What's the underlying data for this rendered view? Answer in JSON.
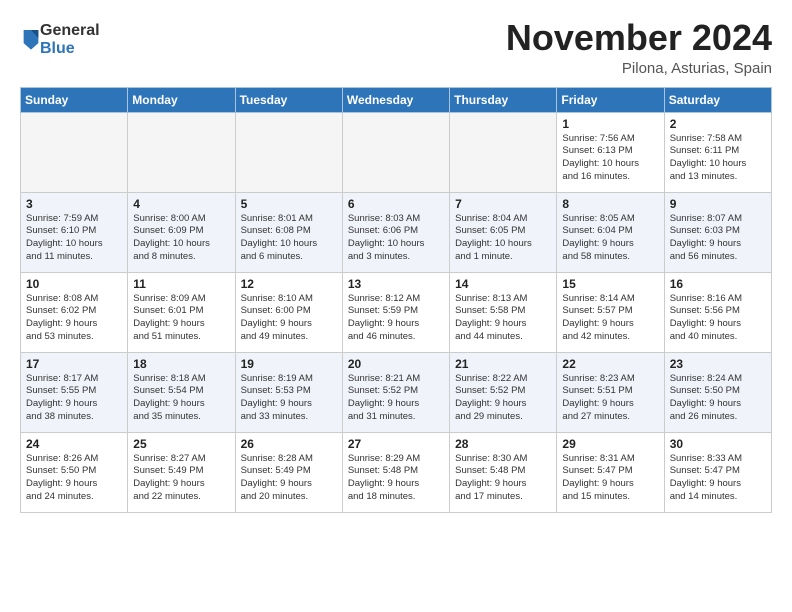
{
  "logo": {
    "general": "General",
    "blue": "Blue"
  },
  "header": {
    "month": "November 2024",
    "location": "Pilona, Asturias, Spain"
  },
  "weekdays": [
    "Sunday",
    "Monday",
    "Tuesday",
    "Wednesday",
    "Thursday",
    "Friday",
    "Saturday"
  ],
  "weeks": [
    [
      {
        "day": "",
        "info": ""
      },
      {
        "day": "",
        "info": ""
      },
      {
        "day": "",
        "info": ""
      },
      {
        "day": "",
        "info": ""
      },
      {
        "day": "",
        "info": ""
      },
      {
        "day": "1",
        "info": "Sunrise: 7:56 AM\nSunset: 6:13 PM\nDaylight: 10 hours\nand 16 minutes."
      },
      {
        "day": "2",
        "info": "Sunrise: 7:58 AM\nSunset: 6:11 PM\nDaylight: 10 hours\nand 13 minutes."
      }
    ],
    [
      {
        "day": "3",
        "info": "Sunrise: 7:59 AM\nSunset: 6:10 PM\nDaylight: 10 hours\nand 11 minutes."
      },
      {
        "day": "4",
        "info": "Sunrise: 8:00 AM\nSunset: 6:09 PM\nDaylight: 10 hours\nand 8 minutes."
      },
      {
        "day": "5",
        "info": "Sunrise: 8:01 AM\nSunset: 6:08 PM\nDaylight: 10 hours\nand 6 minutes."
      },
      {
        "day": "6",
        "info": "Sunrise: 8:03 AM\nSunset: 6:06 PM\nDaylight: 10 hours\nand 3 minutes."
      },
      {
        "day": "7",
        "info": "Sunrise: 8:04 AM\nSunset: 6:05 PM\nDaylight: 10 hours\nand 1 minute."
      },
      {
        "day": "8",
        "info": "Sunrise: 8:05 AM\nSunset: 6:04 PM\nDaylight: 9 hours\nand 58 minutes."
      },
      {
        "day": "9",
        "info": "Sunrise: 8:07 AM\nSunset: 6:03 PM\nDaylight: 9 hours\nand 56 minutes."
      }
    ],
    [
      {
        "day": "10",
        "info": "Sunrise: 8:08 AM\nSunset: 6:02 PM\nDaylight: 9 hours\nand 53 minutes."
      },
      {
        "day": "11",
        "info": "Sunrise: 8:09 AM\nSunset: 6:01 PM\nDaylight: 9 hours\nand 51 minutes."
      },
      {
        "day": "12",
        "info": "Sunrise: 8:10 AM\nSunset: 6:00 PM\nDaylight: 9 hours\nand 49 minutes."
      },
      {
        "day": "13",
        "info": "Sunrise: 8:12 AM\nSunset: 5:59 PM\nDaylight: 9 hours\nand 46 minutes."
      },
      {
        "day": "14",
        "info": "Sunrise: 8:13 AM\nSunset: 5:58 PM\nDaylight: 9 hours\nand 44 minutes."
      },
      {
        "day": "15",
        "info": "Sunrise: 8:14 AM\nSunset: 5:57 PM\nDaylight: 9 hours\nand 42 minutes."
      },
      {
        "day": "16",
        "info": "Sunrise: 8:16 AM\nSunset: 5:56 PM\nDaylight: 9 hours\nand 40 minutes."
      }
    ],
    [
      {
        "day": "17",
        "info": "Sunrise: 8:17 AM\nSunset: 5:55 PM\nDaylight: 9 hours\nand 38 minutes."
      },
      {
        "day": "18",
        "info": "Sunrise: 8:18 AM\nSunset: 5:54 PM\nDaylight: 9 hours\nand 35 minutes."
      },
      {
        "day": "19",
        "info": "Sunrise: 8:19 AM\nSunset: 5:53 PM\nDaylight: 9 hours\nand 33 minutes."
      },
      {
        "day": "20",
        "info": "Sunrise: 8:21 AM\nSunset: 5:52 PM\nDaylight: 9 hours\nand 31 minutes."
      },
      {
        "day": "21",
        "info": "Sunrise: 8:22 AM\nSunset: 5:52 PM\nDaylight: 9 hours\nand 29 minutes."
      },
      {
        "day": "22",
        "info": "Sunrise: 8:23 AM\nSunset: 5:51 PM\nDaylight: 9 hours\nand 27 minutes."
      },
      {
        "day": "23",
        "info": "Sunrise: 8:24 AM\nSunset: 5:50 PM\nDaylight: 9 hours\nand 26 minutes."
      }
    ],
    [
      {
        "day": "24",
        "info": "Sunrise: 8:26 AM\nSunset: 5:50 PM\nDaylight: 9 hours\nand 24 minutes."
      },
      {
        "day": "25",
        "info": "Sunrise: 8:27 AM\nSunset: 5:49 PM\nDaylight: 9 hours\nand 22 minutes."
      },
      {
        "day": "26",
        "info": "Sunrise: 8:28 AM\nSunset: 5:49 PM\nDaylight: 9 hours\nand 20 minutes."
      },
      {
        "day": "27",
        "info": "Sunrise: 8:29 AM\nSunset: 5:48 PM\nDaylight: 9 hours\nand 18 minutes."
      },
      {
        "day": "28",
        "info": "Sunrise: 8:30 AM\nSunset: 5:48 PM\nDaylight: 9 hours\nand 17 minutes."
      },
      {
        "day": "29",
        "info": "Sunrise: 8:31 AM\nSunset: 5:47 PM\nDaylight: 9 hours\nand 15 minutes."
      },
      {
        "day": "30",
        "info": "Sunrise: 8:33 AM\nSunset: 5:47 PM\nDaylight: 9 hours\nand 14 minutes."
      }
    ]
  ]
}
